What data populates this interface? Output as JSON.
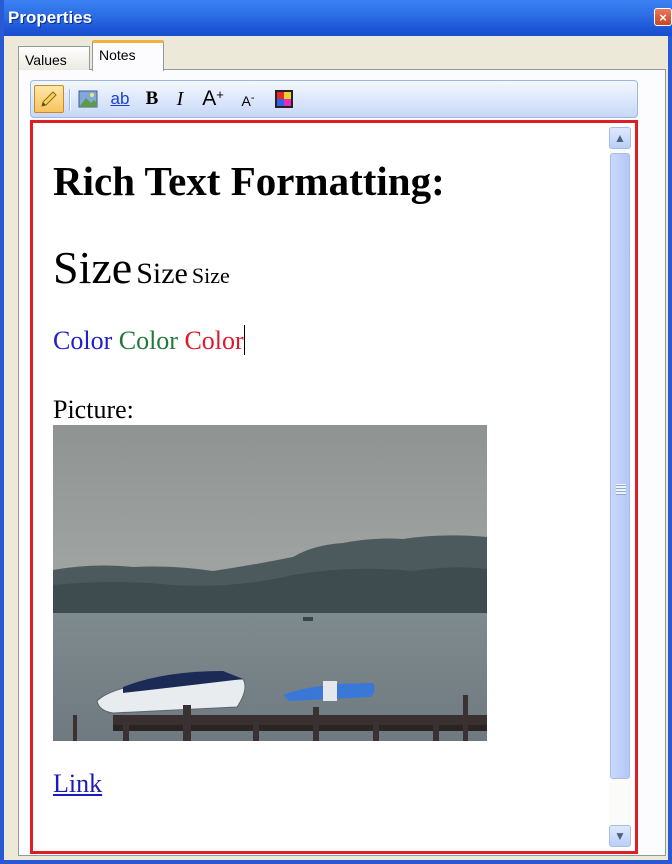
{
  "window": {
    "title": "Properties",
    "close_symbol": "×"
  },
  "tabs": [
    {
      "label": "Values",
      "active": false
    },
    {
      "label": "Notes",
      "active": true
    }
  ],
  "toolbar": {
    "buttons": [
      {
        "name": "pencil-icon",
        "active": true
      },
      {
        "name": "insert-picture-icon"
      },
      {
        "name": "insert-link-button",
        "label": "ab"
      },
      {
        "name": "bold-button",
        "label": "B"
      },
      {
        "name": "italic-button",
        "label": "I"
      },
      {
        "name": "grow-font-button",
        "label": "A",
        "sup": "+"
      },
      {
        "name": "shrink-font-button",
        "label": "A",
        "sup": "-"
      },
      {
        "name": "font-color-icon"
      }
    ]
  },
  "editor": {
    "heading": "Rich Text Formatting:",
    "sizes": [
      "Size",
      "Size",
      "Size"
    ],
    "colors": [
      {
        "text": "Color",
        "color": "#2020cc"
      },
      {
        "text": "Color",
        "color": "#207a3a"
      },
      {
        "text": "Color",
        "color": "#e0182a"
      }
    ],
    "picture_label": "Picture:",
    "link_text": "Link"
  },
  "accent": {
    "title_bar": "#2e6fe6",
    "editor_border": "#dd1f24",
    "active_tab": "#f3b03e"
  }
}
